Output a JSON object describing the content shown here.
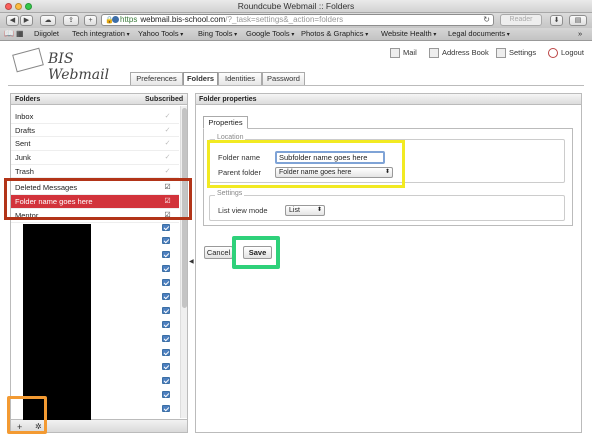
{
  "browser": {
    "window_title": "Roundcube Webmail :: Folders",
    "url_scheme": "https",
    "url_host": "webmail.bis-school.com",
    "url_path": "/?_task=settings&_action=folders",
    "reader_label": "Reader",
    "bookmarks": [
      "Diigolet",
      "Tech integration",
      "Yahoo Tools",
      "Bing Tools",
      "Google Tools",
      "Photos & Graphics",
      "Website Health",
      "Legal documents"
    ]
  },
  "app": {
    "logo_text": "BIS Webmail",
    "topnav": {
      "mail": "Mail",
      "address_book": "Address Book",
      "settings": "Settings",
      "logout": "Logout"
    },
    "tabs": [
      "Preferences",
      "Folders",
      "Identities",
      "Password"
    ],
    "active_tab": "Folders"
  },
  "folders": {
    "header_name": "Folders",
    "header_subscribed": "Subscribed",
    "items": [
      {
        "name": "Inbox",
        "subscribed": true
      },
      {
        "name": "Drafts",
        "subscribed": true
      },
      {
        "name": "Sent",
        "subscribed": true
      },
      {
        "name": "Junk",
        "subscribed": true
      },
      {
        "name": "Trash",
        "subscribed": true
      },
      {
        "name": "Deleted Messages",
        "subscribed": true
      },
      {
        "name": "Folder name goes here",
        "subscribed": true,
        "selected": true
      },
      {
        "name": "Mentor",
        "subscribed": true
      }
    ],
    "footer_add": "+",
    "footer_gear": "✲"
  },
  "properties": {
    "header": "Folder properties",
    "tab": "Properties",
    "location_legend": "Location",
    "folder_name_label": "Folder name",
    "folder_name_value": "Subfolder name goes here",
    "parent_folder_label": "Parent folder",
    "parent_folder_value": "Folder name goes here",
    "settings_legend": "Settings",
    "list_view_mode_label": "List view mode",
    "list_view_mode_value": "List",
    "cancel_label": "Cancel",
    "save_label": "Save"
  },
  "colors": {
    "selected_row": "#d2333b",
    "highlight_red": "#b23418",
    "highlight_yellow": "#f2ea22",
    "highlight_green": "#2ed17a",
    "highlight_orange": "#f39a32"
  }
}
